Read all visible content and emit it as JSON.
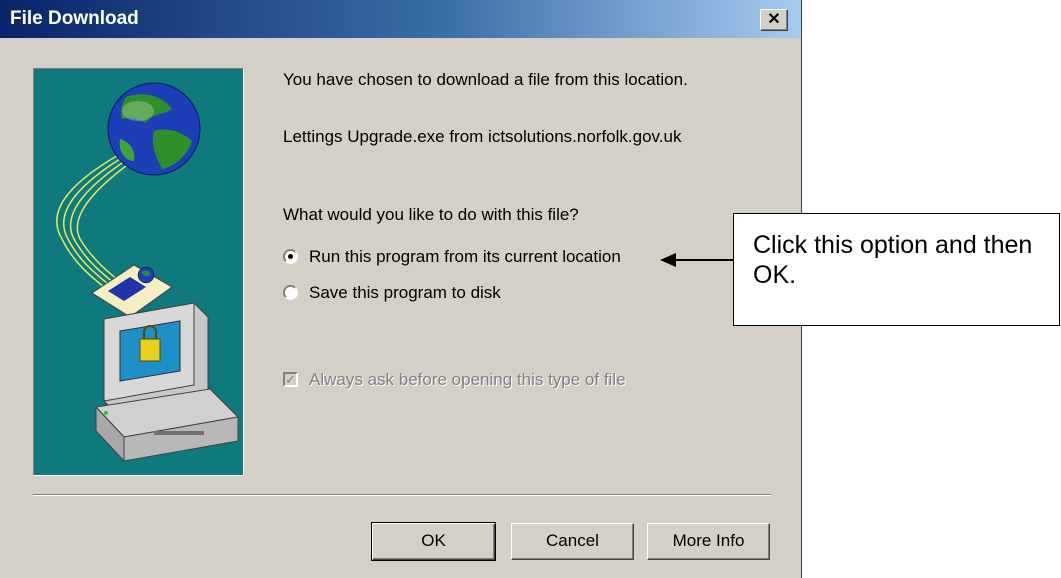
{
  "window": {
    "title": "File Download",
    "close_glyph": "✕"
  },
  "message": {
    "intro": "You have chosen to download a file from this location.",
    "file_location": "Lettings Upgrade.exe from ictsolutions.norfolk.gov.uk",
    "question": "What would you like to do with this file?"
  },
  "options": [
    {
      "label": "Run this program from its current location",
      "selected": true
    },
    {
      "label": "Save this program to disk",
      "selected": false
    }
  ],
  "checkbox": {
    "label": "Always ask before opening this type of file",
    "checked": true,
    "enabled": false
  },
  "buttons": {
    "ok": "OK",
    "cancel": "Cancel",
    "more_info": "More Info"
  },
  "callout": {
    "text": "Click this option and then OK."
  },
  "icons": [
    "close-icon",
    "globe-icon",
    "document-icon",
    "computer-lock-icon"
  ],
  "colors": {
    "title_bar_start": "#0a246a",
    "title_bar_end": "#a6caf0",
    "dialog_face": "#d4d0c8",
    "illustration_bg": "#0f7a7e"
  }
}
